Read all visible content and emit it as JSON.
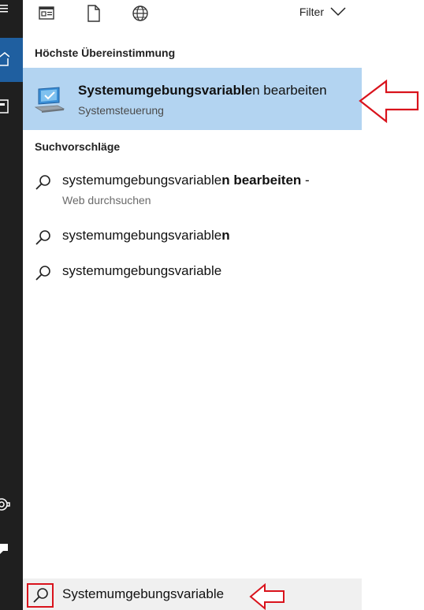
{
  "topbar": {
    "filter_label": "Filter"
  },
  "best_match": {
    "heading": "Höchste Übereinstimmung",
    "title_bold": "Systemumgebungsvariable",
    "title_rest": "n bearbeiten",
    "subtitle": "Systemsteuerung"
  },
  "suggestions": {
    "heading": "Suchvorschläge",
    "items": [
      {
        "normal": "systemumgebungsvariable",
        "bold": "n bearbeiten",
        "suffix": " -",
        "sub": "Web durchsuchen"
      },
      {
        "normal": "systemumgebungsvariable",
        "bold": "n",
        "suffix": "",
        "sub": ""
      },
      {
        "normal": "systemumgebungsvariable",
        "bold": "",
        "suffix": "",
        "sub": ""
      }
    ]
  },
  "search": {
    "value": "Systemumgebungsvariable"
  },
  "colors": {
    "highlight": "#b3d4f1",
    "annotation": "#d9131c",
    "rail": "#1f1f1f",
    "rail_active": "#1f5fa0"
  }
}
